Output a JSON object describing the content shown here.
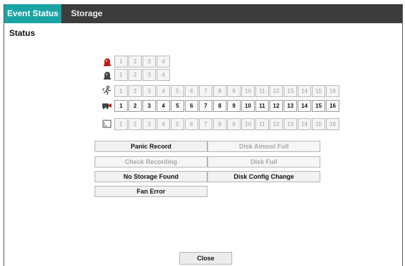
{
  "tabs": [
    {
      "label": "Event Status",
      "active": true
    },
    {
      "label": "Storage",
      "active": false
    }
  ],
  "section_title": "Status",
  "rows": [
    {
      "icon": "alarm-light-icon",
      "cells": [
        "1",
        "2",
        "3",
        "4"
      ],
      "active": false
    },
    {
      "icon": "alarm-out-icon",
      "cells": [
        "1",
        "2",
        "3",
        "4"
      ],
      "active": false
    },
    {
      "icon": "motion-icon",
      "cells": [
        "1",
        "2",
        "3",
        "4",
        "5",
        "6",
        "7",
        "8",
        "9",
        "10",
        "11",
        "12",
        "13",
        "14",
        "15",
        "16"
      ],
      "active": false
    },
    {
      "icon": "video-loss-icon",
      "cells": [
        "1",
        "2",
        "3",
        "4",
        "5",
        "6",
        "7",
        "8",
        "9",
        "10",
        "11",
        "12",
        "13",
        "14",
        "15",
        "16"
      ],
      "active": true
    },
    {
      "icon": "text-in-icon",
      "cells": [
        "1",
        "2",
        "3",
        "4",
        "5",
        "6",
        "7",
        "8",
        "9",
        "10",
        "11",
        "12",
        "13",
        "14",
        "15",
        "16"
      ],
      "active": false
    }
  ],
  "status_buttons": [
    {
      "label": "Panic Record",
      "enabled": true
    },
    {
      "label": "Disk Almost Full",
      "enabled": false
    },
    {
      "label": "Check Recording",
      "enabled": false
    },
    {
      "label": "Disk Full",
      "enabled": false
    },
    {
      "label": "No Storage Found",
      "enabled": true
    },
    {
      "label": "Disk Config Change",
      "enabled": true
    },
    {
      "label": "Fan Error",
      "enabled": true
    }
  ],
  "close_label": "Close",
  "colors": {
    "active_tab": "#1aa3a3",
    "tabbar": "#3c3c3c",
    "alarm_red": "#c4191a"
  }
}
